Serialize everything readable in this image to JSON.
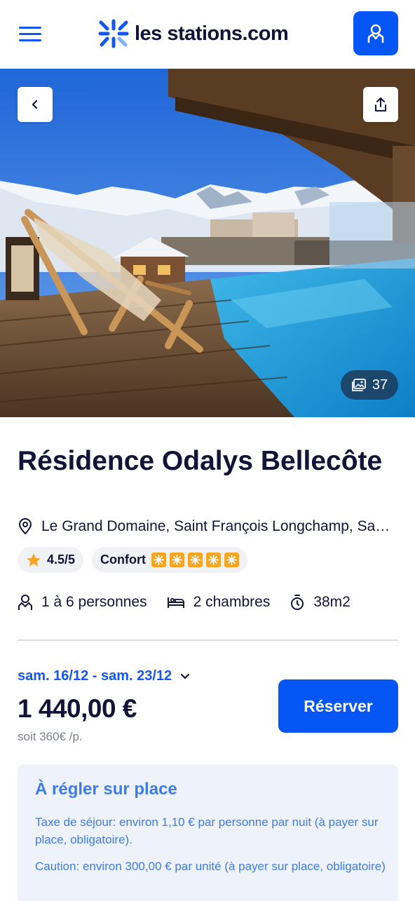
{
  "header": {
    "brand": "les stations.com",
    "menu_icon": "hamburger-icon",
    "account_icon": "user-icon"
  },
  "hero": {
    "photo_count": "37",
    "back_icon": "chevron-left-icon",
    "share_icon": "share-icon",
    "gallery_icon": "gallery-icon"
  },
  "listing": {
    "title": "Résidence Odalys Bellecôte",
    "location": "Le Grand Domaine, Saint François Longchamp, Savoie",
    "rating": "4.5/5",
    "comfort_label": "Confort",
    "comfort_level": 5,
    "specs": {
      "persons": "1 à 6 personnes",
      "rooms": "2 chambres",
      "surface": "38m2"
    }
  },
  "booking": {
    "dates": "sam. 16/12 - sam. 23/12",
    "price": "1 440,00 €",
    "per_person": "soit 360€ /p.",
    "reserve_label": "Réserver"
  },
  "onsite": {
    "title": "À régler sur place",
    "tax": "Taxe de séjour: environ 1,10 € par personne par nuit (à payer sur place, obligatoire).",
    "deposit": "Caution: environ 300,00 € par unité (à payer sur place, obligatoire)"
  },
  "colors": {
    "brand_blue": "#0656f5",
    "text_dark": "#111338",
    "sun_orange": "#f6a623",
    "info_blue": "#3f7be8",
    "star": "#f6a623"
  }
}
